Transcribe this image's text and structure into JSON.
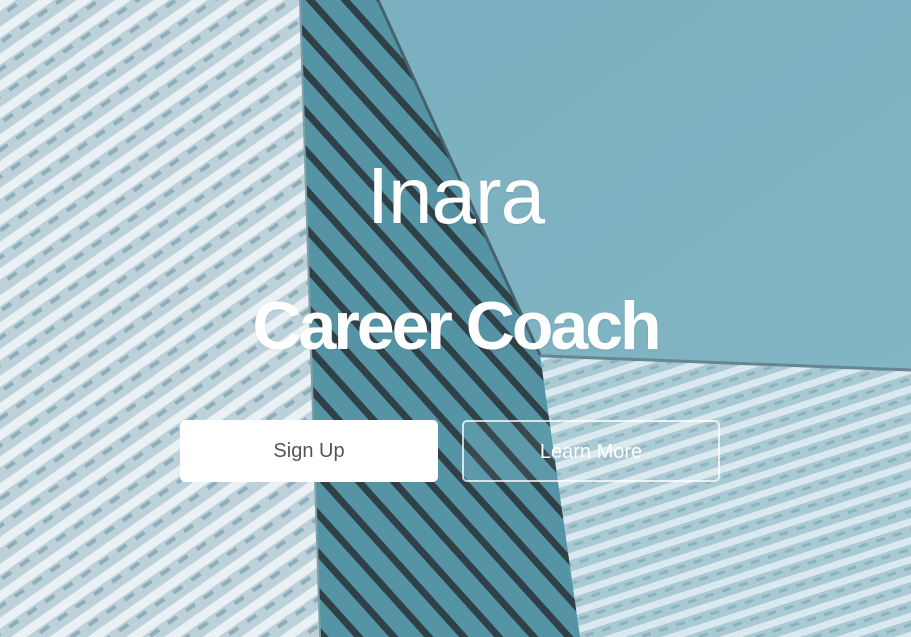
{
  "hero": {
    "title": "Inara",
    "subtitle": "Career Coach",
    "background_image": "building-facade-looking-up",
    "buttons": {
      "signup_label": "Sign Up",
      "learn_more_label": "Learn More"
    }
  },
  "colors": {
    "sky": "#6aa5b6",
    "facade_light": "#c9dbe3",
    "facade_dark": "#2d3e45",
    "button_bg": "#ffffff",
    "button_text": "#555555",
    "text": "#ffffff"
  }
}
